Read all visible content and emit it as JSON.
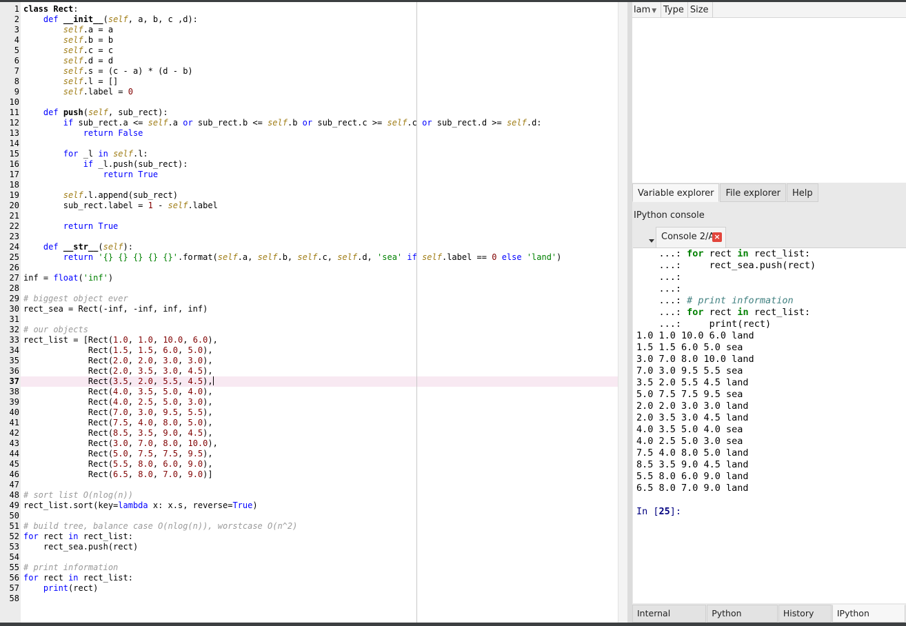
{
  "editor": {
    "current_line": 37,
    "lines": [
      [
        [
          "def",
          "class "
        ],
        [
          "def",
          "Rect"
        ],
        [
          "t",
          ":"
        ]
      ],
      [
        [
          "t",
          "    "
        ],
        [
          "kw",
          "def "
        ],
        [
          "def",
          "__init__"
        ],
        [
          "t",
          "("
        ],
        [
          "self",
          "self"
        ],
        [
          "t",
          ", a, b, c ,d):"
        ]
      ],
      [
        [
          "t",
          "        "
        ],
        [
          "self",
          "self"
        ],
        [
          "t",
          ".a = a"
        ]
      ],
      [
        [
          "t",
          "        "
        ],
        [
          "self",
          "self"
        ],
        [
          "t",
          ".b = b"
        ]
      ],
      [
        [
          "t",
          "        "
        ],
        [
          "self",
          "self"
        ],
        [
          "t",
          ".c = c"
        ]
      ],
      [
        [
          "t",
          "        "
        ],
        [
          "self",
          "self"
        ],
        [
          "t",
          ".d = d"
        ]
      ],
      [
        [
          "t",
          "        "
        ],
        [
          "self",
          "self"
        ],
        [
          "t",
          ".s = (c - a) * (d - b)"
        ]
      ],
      [
        [
          "t",
          "        "
        ],
        [
          "self",
          "self"
        ],
        [
          "t",
          ".l = []"
        ]
      ],
      [
        [
          "t",
          "        "
        ],
        [
          "self",
          "self"
        ],
        [
          "t",
          ".label = "
        ],
        [
          "num",
          "0"
        ]
      ],
      [],
      [
        [
          "t",
          "    "
        ],
        [
          "kw",
          "def "
        ],
        [
          "def",
          "push"
        ],
        [
          "t",
          "("
        ],
        [
          "self",
          "self"
        ],
        [
          "t",
          ", sub_rect):"
        ]
      ],
      [
        [
          "t",
          "        "
        ],
        [
          "kw",
          "if "
        ],
        [
          "t",
          "sub_rect.a <= "
        ],
        [
          "self",
          "self"
        ],
        [
          "t",
          ".a "
        ],
        [
          "kw",
          "or "
        ],
        [
          "t",
          "sub_rect.b <= "
        ],
        [
          "self",
          "self"
        ],
        [
          "t",
          ".b "
        ],
        [
          "kw",
          "or "
        ],
        [
          "t",
          "sub_rect.c >= "
        ],
        [
          "self",
          "self"
        ],
        [
          "t",
          ".c "
        ],
        [
          "kw",
          "or "
        ],
        [
          "t",
          "sub_rect.d >= "
        ],
        [
          "self",
          "self"
        ],
        [
          "t",
          ".d:"
        ]
      ],
      [
        [
          "t",
          "            "
        ],
        [
          "kw",
          "return False"
        ]
      ],
      [],
      [
        [
          "t",
          "        "
        ],
        [
          "kw",
          "for "
        ],
        [
          "t",
          "_l "
        ],
        [
          "kw",
          "in "
        ],
        [
          "self",
          "self"
        ],
        [
          "t",
          ".l:"
        ]
      ],
      [
        [
          "t",
          "            "
        ],
        [
          "kw",
          "if "
        ],
        [
          "t",
          "_l.push(sub_rect):"
        ]
      ],
      [
        [
          "t",
          "                "
        ],
        [
          "kw",
          "return True"
        ]
      ],
      [],
      [
        [
          "t",
          "        "
        ],
        [
          "self",
          "self"
        ],
        [
          "t",
          ".l.append(sub_rect)"
        ]
      ],
      [
        [
          "t",
          "        sub_rect.label = "
        ],
        [
          "num",
          "1"
        ],
        [
          "t",
          " - "
        ],
        [
          "self",
          "self"
        ],
        [
          "t",
          ".label"
        ]
      ],
      [],
      [
        [
          "t",
          "        "
        ],
        [
          "kw",
          "return True"
        ]
      ],
      [],
      [
        [
          "t",
          "    "
        ],
        [
          "kw",
          "def "
        ],
        [
          "def",
          "__str__"
        ],
        [
          "t",
          "("
        ],
        [
          "self",
          "self"
        ],
        [
          "t",
          "):"
        ]
      ],
      [
        [
          "t",
          "        "
        ],
        [
          "kw",
          "return "
        ],
        [
          "str",
          "'{} {} {} {} {}'"
        ],
        [
          "t",
          ".format("
        ],
        [
          "self",
          "self"
        ],
        [
          "t",
          ".a, "
        ],
        [
          "self",
          "self"
        ],
        [
          "t",
          ".b, "
        ],
        [
          "self",
          "self"
        ],
        [
          "t",
          ".c, "
        ],
        [
          "self",
          "self"
        ],
        [
          "t",
          ".d, "
        ],
        [
          "str",
          "'sea'"
        ],
        [
          "t",
          " "
        ],
        [
          "kw",
          "if "
        ],
        [
          "self",
          "self"
        ],
        [
          "t",
          ".label == "
        ],
        [
          "num",
          "0"
        ],
        [
          "t",
          " "
        ],
        [
          "kw",
          "else "
        ],
        [
          "str",
          "'land'"
        ],
        [
          "t",
          ")"
        ]
      ],
      [],
      [
        [
          "t",
          "inf = "
        ],
        [
          "kw",
          "float"
        ],
        [
          "t",
          "("
        ],
        [
          "str",
          "'inf'"
        ],
        [
          "t",
          ")"
        ]
      ],
      [],
      [
        [
          "com",
          "# biggest object ever"
        ]
      ],
      [
        [
          "t",
          "rect_sea = Rect(-inf, -inf, inf, inf)"
        ]
      ],
      [],
      [
        [
          "com",
          "# our objects"
        ]
      ],
      [
        [
          "t",
          "rect_list = [Rect("
        ],
        [
          "num",
          "1.0"
        ],
        [
          "t",
          ", "
        ],
        [
          "num",
          "1.0"
        ],
        [
          "t",
          ", "
        ],
        [
          "num",
          "10.0"
        ],
        [
          "t",
          ", "
        ],
        [
          "num",
          "6.0"
        ],
        [
          "t",
          "),"
        ]
      ],
      [
        [
          "t",
          "             Rect("
        ],
        [
          "num",
          "1.5"
        ],
        [
          "t",
          ", "
        ],
        [
          "num",
          "1.5"
        ],
        [
          "t",
          ", "
        ],
        [
          "num",
          "6.0"
        ],
        [
          "t",
          ", "
        ],
        [
          "num",
          "5.0"
        ],
        [
          "t",
          "),"
        ]
      ],
      [
        [
          "t",
          "             Rect("
        ],
        [
          "num",
          "2.0"
        ],
        [
          "t",
          ", "
        ],
        [
          "num",
          "2.0"
        ],
        [
          "t",
          ", "
        ],
        [
          "num",
          "3.0"
        ],
        [
          "t",
          ", "
        ],
        [
          "num",
          "3.0"
        ],
        [
          "t",
          "),"
        ]
      ],
      [
        [
          "t",
          "             Rect("
        ],
        [
          "num",
          "2.0"
        ],
        [
          "t",
          ", "
        ],
        [
          "num",
          "3.5"
        ],
        [
          "t",
          ", "
        ],
        [
          "num",
          "3.0"
        ],
        [
          "t",
          ", "
        ],
        [
          "num",
          "4.5"
        ],
        [
          "t",
          "),"
        ]
      ],
      [
        [
          "t",
          "             Rect("
        ],
        [
          "num",
          "3.5"
        ],
        [
          "t",
          ", "
        ],
        [
          "num",
          "2.0"
        ],
        [
          "t",
          ", "
        ],
        [
          "num",
          "5.5"
        ],
        [
          "t",
          ", "
        ],
        [
          "num",
          "4.5"
        ],
        [
          "t",
          "),"
        ]
      ],
      [
        [
          "t",
          "             Rect("
        ],
        [
          "num",
          "4.0"
        ],
        [
          "t",
          ", "
        ],
        [
          "num",
          "3.5"
        ],
        [
          "t",
          ", "
        ],
        [
          "num",
          "5.0"
        ],
        [
          "t",
          ", "
        ],
        [
          "num",
          "4.0"
        ],
        [
          "t",
          "),"
        ]
      ],
      [
        [
          "t",
          "             Rect("
        ],
        [
          "num",
          "4.0"
        ],
        [
          "t",
          ", "
        ],
        [
          "num",
          "2.5"
        ],
        [
          "t",
          ", "
        ],
        [
          "num",
          "5.0"
        ],
        [
          "t",
          ", "
        ],
        [
          "num",
          "3.0"
        ],
        [
          "t",
          "),"
        ]
      ],
      [
        [
          "t",
          "             Rect("
        ],
        [
          "num",
          "7.0"
        ],
        [
          "t",
          ", "
        ],
        [
          "num",
          "3.0"
        ],
        [
          "t",
          ", "
        ],
        [
          "num",
          "9.5"
        ],
        [
          "t",
          ", "
        ],
        [
          "num",
          "5.5"
        ],
        [
          "t",
          "),"
        ]
      ],
      [
        [
          "t",
          "             Rect("
        ],
        [
          "num",
          "7.5"
        ],
        [
          "t",
          ", "
        ],
        [
          "num",
          "4.0"
        ],
        [
          "t",
          ", "
        ],
        [
          "num",
          "8.0"
        ],
        [
          "t",
          ", "
        ],
        [
          "num",
          "5.0"
        ],
        [
          "t",
          "),"
        ]
      ],
      [
        [
          "t",
          "             Rect("
        ],
        [
          "num",
          "8.5"
        ],
        [
          "t",
          ", "
        ],
        [
          "num",
          "3.5"
        ],
        [
          "t",
          ", "
        ],
        [
          "num",
          "9.0"
        ],
        [
          "t",
          ", "
        ],
        [
          "num",
          "4.5"
        ],
        [
          "t",
          "),"
        ]
      ],
      [
        [
          "t",
          "             Rect("
        ],
        [
          "num",
          "3.0"
        ],
        [
          "t",
          ", "
        ],
        [
          "num",
          "7.0"
        ],
        [
          "t",
          ", "
        ],
        [
          "num",
          "8.0"
        ],
        [
          "t",
          ", "
        ],
        [
          "num",
          "10.0"
        ],
        [
          "t",
          "),"
        ]
      ],
      [
        [
          "t",
          "             Rect("
        ],
        [
          "num",
          "5.0"
        ],
        [
          "t",
          ", "
        ],
        [
          "num",
          "7.5"
        ],
        [
          "t",
          ", "
        ],
        [
          "num",
          "7.5"
        ],
        [
          "t",
          ", "
        ],
        [
          "num",
          "9.5"
        ],
        [
          "t",
          "),"
        ]
      ],
      [
        [
          "t",
          "             Rect("
        ],
        [
          "num",
          "5.5"
        ],
        [
          "t",
          ", "
        ],
        [
          "num",
          "8.0"
        ],
        [
          "t",
          ", "
        ],
        [
          "num",
          "6.0"
        ],
        [
          "t",
          ", "
        ],
        [
          "num",
          "9.0"
        ],
        [
          "t",
          "),"
        ]
      ],
      [
        [
          "t",
          "             Rect("
        ],
        [
          "num",
          "6.5"
        ],
        [
          "t",
          ", "
        ],
        [
          "num",
          "8.0"
        ],
        [
          "t",
          ", "
        ],
        [
          "num",
          "7.0"
        ],
        [
          "t",
          ", "
        ],
        [
          "num",
          "9.0"
        ],
        [
          "t",
          ")]"
        ]
      ],
      [],
      [
        [
          "com",
          "# sort list O(nlog(n))"
        ]
      ],
      [
        [
          "t",
          "rect_list.sort(key="
        ],
        [
          "kw",
          "lambda "
        ],
        [
          "t",
          "x: x.s, reverse="
        ],
        [
          "kw",
          "True"
        ],
        [
          "t",
          ")"
        ]
      ],
      [],
      [
        [
          "com",
          "# build tree, balance case O(nlog(n)), worstcase O(n^2)"
        ]
      ],
      [
        [
          "kw",
          "for "
        ],
        [
          "t",
          "rect "
        ],
        [
          "kw",
          "in "
        ],
        [
          "t",
          "rect_list:"
        ]
      ],
      [
        [
          "t",
          "    rect_sea.push(rect)"
        ]
      ],
      [],
      [
        [
          "com",
          "# print information"
        ]
      ],
      [
        [
          "kw",
          "for "
        ],
        [
          "t",
          "rect "
        ],
        [
          "kw",
          "in "
        ],
        [
          "t",
          "rect_list:"
        ]
      ],
      [
        [
          "t",
          "    "
        ],
        [
          "kw",
          "print"
        ],
        [
          "t",
          "(rect)"
        ]
      ],
      []
    ]
  },
  "variable_explorer": {
    "columns": [
      "lam",
      "Type",
      "Size"
    ]
  },
  "upper_tabs": [
    "Variable explorer",
    "File explorer",
    "Help"
  ],
  "pane_title": "IPython console",
  "console_tab": {
    "label": "Console 2/A",
    "close_glyph": "×"
  },
  "console": {
    "lines": [
      [
        [
          "t",
          "    ...: "
        ],
        [
          "kw",
          "for"
        ],
        [
          "t",
          " rect "
        ],
        [
          "kw",
          "in"
        ],
        [
          "t",
          " rect_list:"
        ]
      ],
      [
        [
          "t",
          "    ...:     rect_sea.push(rect)"
        ]
      ],
      [
        [
          "t",
          "    ...:"
        ]
      ],
      [
        [
          "t",
          "    ...:"
        ]
      ],
      [
        [
          "t",
          "    ...: "
        ],
        [
          "com",
          "# print information"
        ]
      ],
      [
        [
          "t",
          "    ...: "
        ],
        [
          "kw",
          "for"
        ],
        [
          "t",
          " rect "
        ],
        [
          "kw",
          "in"
        ],
        [
          "t",
          " rect_list:"
        ]
      ],
      [
        [
          "t",
          "    ...:     "
        ],
        [
          "t2",
          "print"
        ],
        [
          "t",
          "(rect)"
        ]
      ],
      [
        [
          "t",
          "1.0 1.0 10.0 6.0 land"
        ]
      ],
      [
        [
          "t",
          "1.5 1.5 6.0 5.0 sea"
        ]
      ],
      [
        [
          "t",
          "3.0 7.0 8.0 10.0 land"
        ]
      ],
      [
        [
          "t",
          "7.0 3.0 9.5 5.5 sea"
        ]
      ],
      [
        [
          "t",
          "3.5 2.0 5.5 4.5 land"
        ]
      ],
      [
        [
          "t",
          "5.0 7.5 7.5 9.5 sea"
        ]
      ],
      [
        [
          "t",
          "2.0 2.0 3.0 3.0 land"
        ]
      ],
      [
        [
          "t",
          "2.0 3.5 3.0 4.5 land"
        ]
      ],
      [
        [
          "t",
          "4.0 3.5 5.0 4.0 sea"
        ]
      ],
      [
        [
          "t",
          "4.0 2.5 5.0 3.0 sea"
        ]
      ],
      [
        [
          "t",
          "7.5 4.0 8.0 5.0 land"
        ]
      ],
      [
        [
          "t",
          "8.5 3.5 9.0 4.5 land"
        ]
      ],
      [
        [
          "t",
          "5.5 8.0 6.0 9.0 land"
        ]
      ],
      [
        [
          "t",
          "6.5 8.0 7.0 9.0 land"
        ]
      ],
      [],
      [
        [
          "p",
          "In ["
        ],
        [
          "pn",
          "25"
        ],
        [
          "p",
          "]:"
        ]
      ]
    ]
  },
  "bottom_tabs": [
    "Internal console",
    "Python console",
    "History log",
    "IPython console"
  ],
  "active_bottom_tab": "IPython console"
}
